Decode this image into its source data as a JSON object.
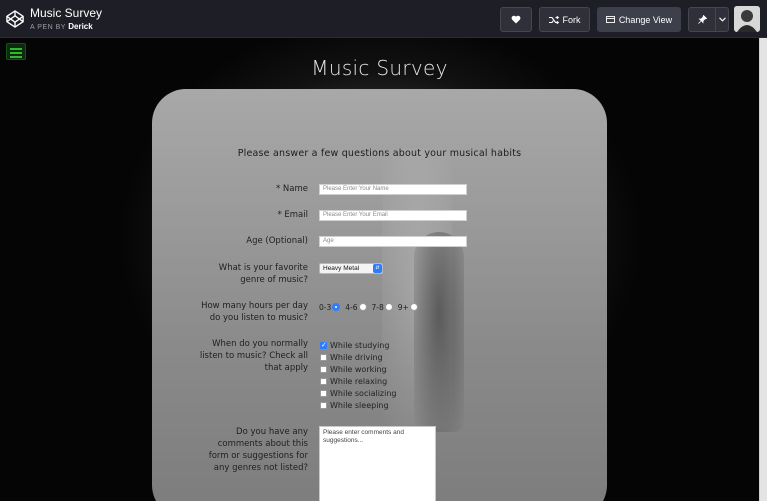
{
  "topbar": {
    "pen_title": "Music Survey",
    "pen_by_prefix": "A PEN BY",
    "author": "Derick",
    "fork_label": "Fork",
    "change_view_label": "Change View"
  },
  "survey": {
    "title": "Music Survey",
    "intro": "Please answer a few questions about your musical habits",
    "name_label": "* Name",
    "name_placeholder": "Please Enter Your Name",
    "email_label": "* Email",
    "email_placeholder": "Please Enter Your Email",
    "age_label": "Age (Optional)",
    "age_placeholder": "Age",
    "genre_label": "What is your favorite genre of music?",
    "genre_selected": "Heavy Metal",
    "hours_label": "How many hours per day do you listen to music?",
    "hours_options": [
      "0-3",
      "4-6",
      "7-8",
      "9+"
    ],
    "hours_selected": "0-3",
    "when_label": "When do you normally listen to music? Check all that apply",
    "when_options": [
      {
        "label": "While studying",
        "checked": true
      },
      {
        "label": "While driving",
        "checked": false
      },
      {
        "label": "While working",
        "checked": false
      },
      {
        "label": "While relaxing",
        "checked": false
      },
      {
        "label": "While socializing",
        "checked": false
      },
      {
        "label": "While sleeping",
        "checked": false
      }
    ],
    "comments_label": "Do you have any comments about this form or suggestions for any genres not listed?",
    "comments_placeholder": "Please enter comments and suggestions..."
  },
  "colors": {
    "accent": "#2f7dff",
    "menu_green": "#2fb82f",
    "topbar_bg": "#1e1f26"
  },
  "icons": {
    "logo": "codepen-logo-icon",
    "heart": "heart-icon",
    "fork": "fork-icon",
    "change_view": "layout-icon",
    "pin": "pin-icon",
    "caret": "chevron-down-icon",
    "menu": "hamburger-menu-icon"
  }
}
